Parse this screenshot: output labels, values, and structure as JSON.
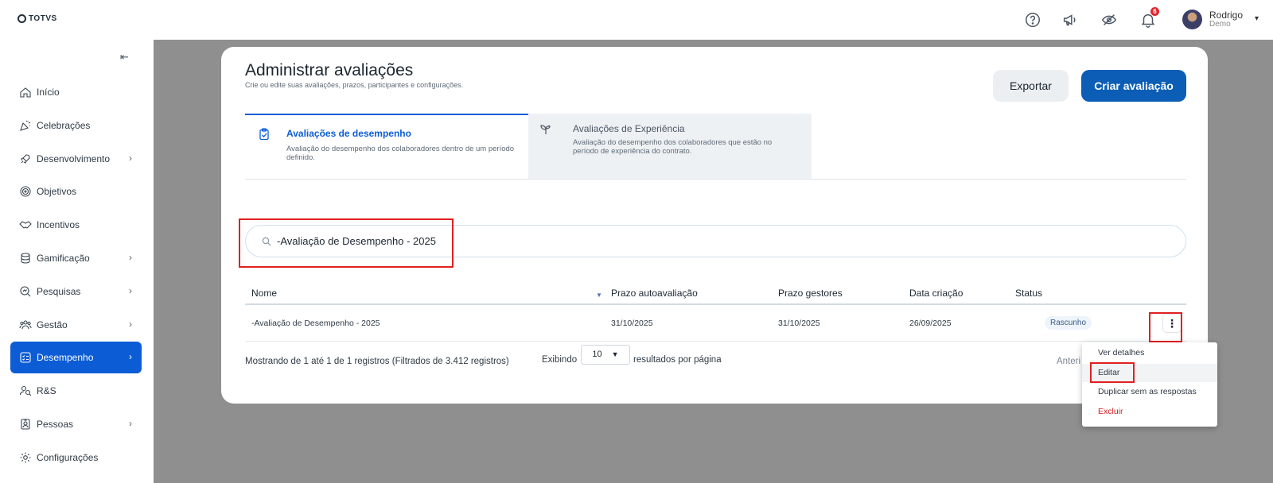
{
  "app": {
    "logo_text": "TOTVS"
  },
  "topbar": {
    "icons": [
      "help-icon",
      "megaphone-icon",
      "eye-slash-icon",
      "bell-icon"
    ],
    "notifications_count": "6",
    "user_name": "Rodrigo",
    "user_subtitle": "Demo"
  },
  "sidebar": {
    "collapse_icon": "arrow-left-collapse-icon",
    "items": [
      {
        "label": "Início",
        "icon": "home-icon",
        "has_children": false,
        "active": false
      },
      {
        "label": "Celebrações",
        "icon": "party-icon",
        "has_children": false,
        "active": false
      },
      {
        "label": "Desenvolvimento",
        "icon": "rocket-icon",
        "has_children": true,
        "active": false
      },
      {
        "label": "Objetivos",
        "icon": "target-icon",
        "has_children": false,
        "active": false
      },
      {
        "label": "Incentivos",
        "icon": "handshake-icon",
        "has_children": false,
        "active": false
      },
      {
        "label": "Gamificação",
        "icon": "coins-icon",
        "has_children": true,
        "active": false
      },
      {
        "label": "Pesquisas",
        "icon": "search-doc-icon",
        "has_children": true,
        "active": false
      },
      {
        "label": "Gestão",
        "icon": "team-icon",
        "has_children": true,
        "active": false
      },
      {
        "label": "Desempenho",
        "icon": "checklist-icon",
        "has_children": true,
        "active": true
      },
      {
        "label": "R&S",
        "icon": "users-search-icon",
        "has_children": false,
        "active": false
      },
      {
        "label": "Pessoas",
        "icon": "badge-icon",
        "has_children": true,
        "active": false
      },
      {
        "label": "Configurações",
        "icon": "gear-icon",
        "has_children": false,
        "active": false
      }
    ]
  },
  "page": {
    "title": "Administrar avaliações",
    "subtitle": "Crie ou edite suas avaliações, prazos, participantes e configurações.",
    "export_label": "Exportar",
    "create_label": "Criar avaliação"
  },
  "tabs": [
    {
      "title": "Avaliações de desempenho",
      "desc": "Avaliação do desempenho dos colaboradores dentro de um período definido.",
      "icon": "clipboard-check-icon",
      "active": true
    },
    {
      "title": "Avaliações de Experiência",
      "desc": "Avaliação do desempenho dos colaboradores que estão no período de experiência do contrato.",
      "icon": "sprout-icon",
      "active": false
    }
  ],
  "search": {
    "value": "-Avaliação de Desempenho - 2025"
  },
  "table": {
    "columns": [
      "Nome",
      "Prazo autoavaliação",
      "Prazo gestores",
      "Data criação",
      "Status"
    ],
    "rows": [
      {
        "nome": "-Avaliação de Desempenho - 2025",
        "prazo_auto": "31/10/2025",
        "prazo_gestores": "31/10/2025",
        "data_criacao": "26/09/2025",
        "status": "Rascunho"
      }
    ]
  },
  "footer": {
    "info": "Mostrando de 1 até 1 de 1 registros (Filtrados de 3.412 registros)",
    "showing_label": "Exibindo",
    "per_page": "10",
    "per_page_suffix": "resultados por página",
    "prev_label": "Anteri"
  },
  "menu": {
    "items": [
      "Ver detalhes",
      "Editar",
      "Duplicar sem as respostas",
      "Excluir"
    ]
  },
  "colors": {
    "primary": "#0c5dd5",
    "create_button": "#0b5db5",
    "overlay": "#8f8f8f",
    "danger": "#d42020",
    "highlight_box": "#e02020"
  }
}
